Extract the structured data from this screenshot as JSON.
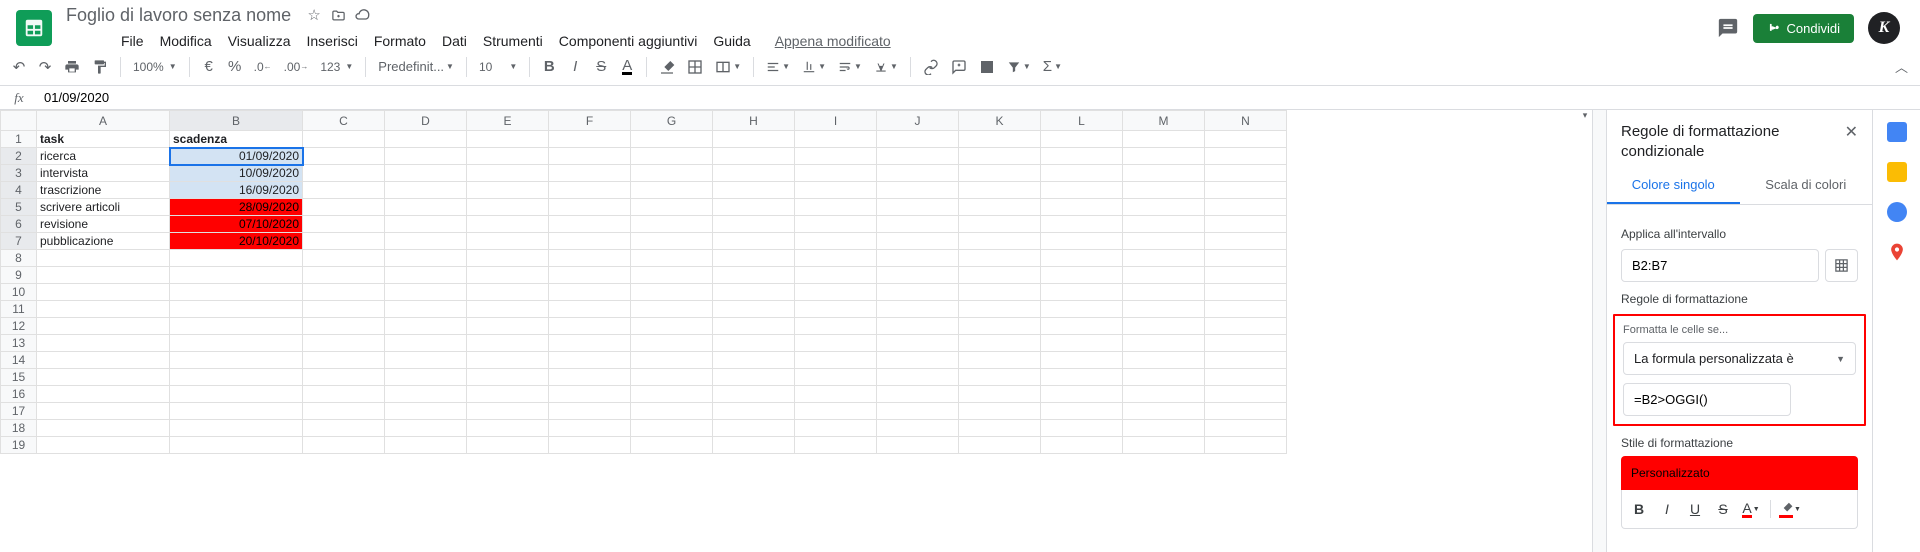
{
  "doc": {
    "title": "Foglio di lavoro senza nome"
  },
  "menu": {
    "file": "File",
    "edit": "Modifica",
    "view": "Visualizza",
    "insert": "Inserisci",
    "format": "Formato",
    "data": "Dati",
    "tools": "Strumenti",
    "addons": "Componenti aggiuntivi",
    "help": "Guida",
    "modified": "Appena modificato"
  },
  "share": {
    "label": "Condividi"
  },
  "toolbar": {
    "zoom": "100%",
    "font": "Predefinit...",
    "fontsize": "10",
    "number_fmt": "123"
  },
  "formula": {
    "value": "01/09/2020"
  },
  "columns": [
    "A",
    "B",
    "C",
    "D",
    "E",
    "F",
    "G",
    "H",
    "I",
    "J",
    "K",
    "L",
    "M",
    "N"
  ],
  "rows": [
    1,
    2,
    3,
    4,
    5,
    6,
    7,
    8,
    9,
    10,
    11,
    12,
    13,
    14,
    15,
    16,
    17,
    18,
    19
  ],
  "headers": {
    "task": "task",
    "scadenza": "scadenza"
  },
  "cells": [
    {
      "task": "ricerca",
      "scadenza": "01/09/2020",
      "red": false
    },
    {
      "task": "intervista",
      "scadenza": "10/09/2020",
      "red": false
    },
    {
      "task": "trascrizione",
      "scadenza": "16/09/2020",
      "red": false
    },
    {
      "task": "scrivere articoli",
      "scadenza": "28/09/2020",
      "red": true
    },
    {
      "task": "revisione",
      "scadenza": "07/10/2020",
      "red": true
    },
    {
      "task": "pubblicazione",
      "scadenza": "20/10/2020",
      "red": true
    }
  ],
  "panel": {
    "title": "Regole di formattazione condizionale",
    "tab_single": "Colore singolo",
    "tab_scale": "Scala di colori",
    "apply_label": "Applica all'intervallo",
    "range": "B2:B7",
    "rules_label": "Regole di formattazione",
    "format_if": "Formatta le celle se...",
    "condition": "La formula personalizzata è",
    "formula": "=B2>OGGI()",
    "style_label": "Stile di formattazione",
    "style_preview": "Personalizzato"
  },
  "colors": {
    "accent_green": "#1a8038",
    "accent_blue": "#1a73e8",
    "danger": "#ff0000"
  }
}
